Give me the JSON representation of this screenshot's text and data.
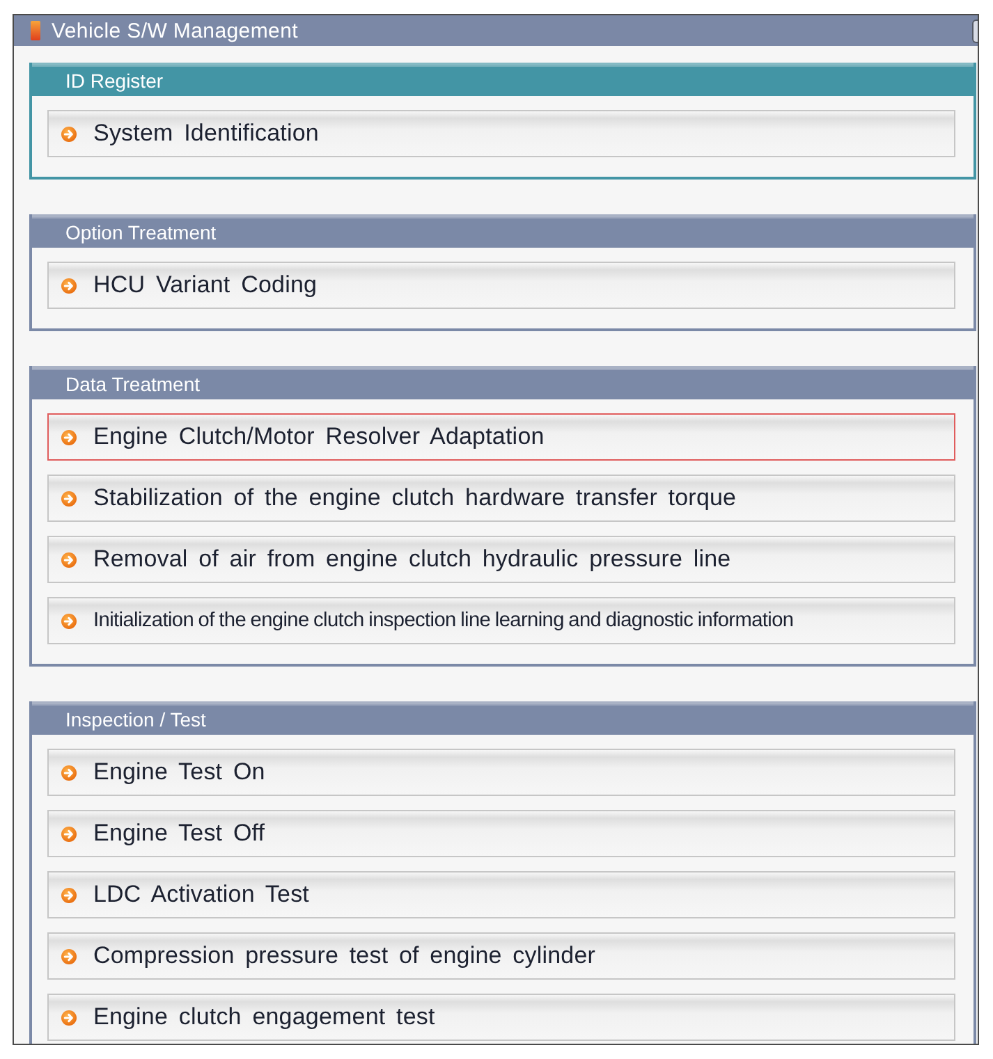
{
  "window": {
    "title": "Vehicle S/W Management"
  },
  "sections": [
    {
      "title": "ID Register",
      "color": "#4395a5",
      "items": [
        {
          "label": "System Identification",
          "selected": false
        }
      ]
    },
    {
      "title": "Option Treatment",
      "color": "#7b89a7",
      "items": [
        {
          "label": "HCU Variant Coding",
          "selected": false
        }
      ]
    },
    {
      "title": "Data Treatment",
      "color": "#7b89a7",
      "items": [
        {
          "label": "Engine Clutch/Motor Resolver Adaptation",
          "selected": true
        },
        {
          "label": "Stabilization of the engine clutch hardware transfer torque",
          "selected": false
        },
        {
          "label": "Removal of air from engine clutch hydraulic pressure line",
          "selected": false
        },
        {
          "label": "Initialization of the engine clutch inspection line learning and diagnostic information",
          "selected": false
        }
      ]
    },
    {
      "title": "Inspection / Test",
      "color": "#7b89a7",
      "items": [
        {
          "label": "Engine Test On",
          "selected": false
        },
        {
          "label": "Engine Test Off",
          "selected": false
        },
        {
          "label": "LDC Activation Test",
          "selected": false
        },
        {
          "label": "Compression pressure test of engine cylinder",
          "selected": false
        },
        {
          "label": "Engine clutch engagement test",
          "selected": false
        }
      ]
    }
  ]
}
